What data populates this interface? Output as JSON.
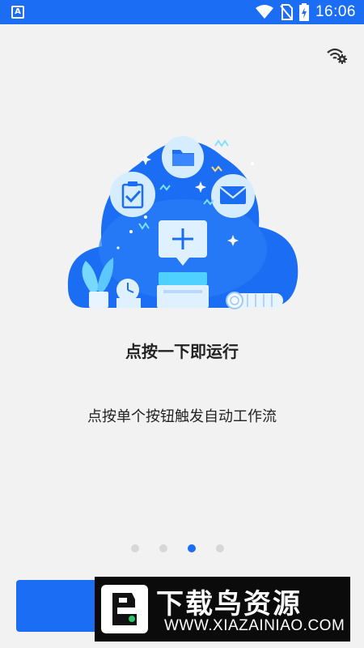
{
  "status_bar": {
    "app_icon_letter": "A",
    "time": "16:06",
    "icons": [
      "wifi-icon",
      "no-sim-icon",
      "battery-charging-icon"
    ]
  },
  "top_actions": {
    "settings_icon": "wifi-settings-icon"
  },
  "hero": {
    "icons": [
      "folder-icon",
      "clipboard-check-icon",
      "mail-icon",
      "plus-button-icon",
      "clock-icon",
      "plant-icon",
      "log-roll-icon"
    ],
    "colors": {
      "cloud": "#1b6ef3",
      "accent_light": "#bfe3ff"
    }
  },
  "onboarding": {
    "title": "点按一下即运行",
    "subtitle": "点按单个按钮触发自动工作流",
    "page_count": 4,
    "current_page": 3
  },
  "watermark": {
    "title": "下载鸟资源",
    "url": "WWW.XIAZAINIAO.COM"
  },
  "colors": {
    "primary": "#1b6ef3",
    "background": "#f2f2f2",
    "dot_inactive": "#d7d7d7"
  }
}
